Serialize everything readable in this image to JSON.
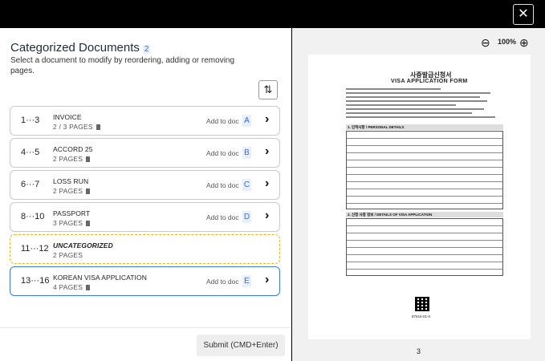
{
  "close_label": "✕",
  "left_panel": {
    "title": "Categorized Documents",
    "count": "2",
    "subtitle": "Select a document to modify by reordering, adding or removing pages.",
    "sort_icon": "sort-list-icon",
    "documents": [
      {
        "range": "1···3",
        "name": "INVOICE",
        "pages": "2 / 3 PAGES",
        "add_label": "Add to doc",
        "letter": "A"
      },
      {
        "range": "4···5",
        "name": "ACCORD 25",
        "pages": "2 PAGES",
        "add_label": "Add to doc",
        "letter": "B"
      },
      {
        "range": "6···7",
        "name": "LOSS RUN",
        "pages": "2 PAGES",
        "add_label": "Add to doc",
        "letter": "C"
      },
      {
        "range": "8···10",
        "name": "PASSPORT",
        "pages": "3 PAGES",
        "add_label": "Add to doc",
        "letter": "D"
      },
      {
        "range": "11···12",
        "name": "UNCATEGORIZED",
        "pages": "2 PAGES"
      },
      {
        "range": "13···16",
        "name": "KOREAN VISA APPLICATION",
        "pages": "4 PAGES",
        "add_label": "Add to doc",
        "letter": "E"
      }
    ],
    "submit_label": "Submit (CMD+Enter)"
  },
  "preview": {
    "zoom": "100%",
    "doc_korean_title": "사증발급신청서",
    "doc_title": "VISA APPLICATION FORM",
    "section_1": "1. 인적사항 / PERSONAL DETAILS",
    "section_2": "2. 신청 사증 정보 / DETAILS OF VISA APPLICATION",
    "doc_number": "87516-01-0",
    "page_number": "3"
  },
  "colors": {
    "accent": "#3a7be0",
    "uncategorized_border": "#f0b41c",
    "letter_bg": "#e8efff"
  }
}
